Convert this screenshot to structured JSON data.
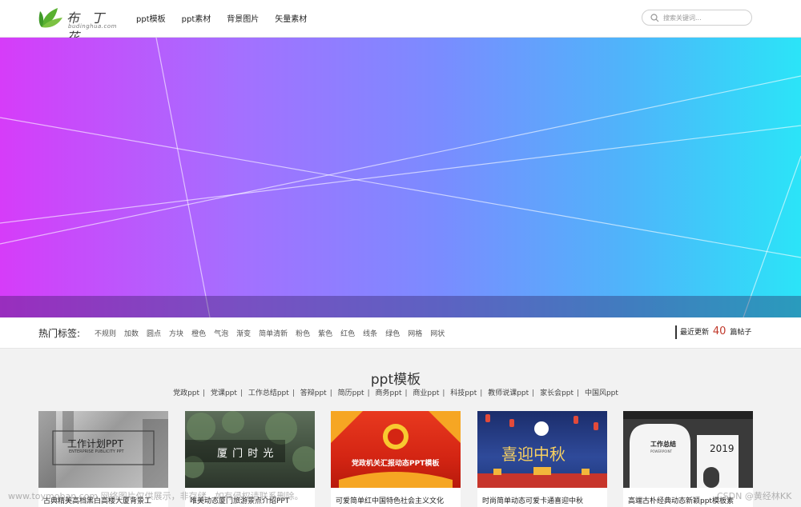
{
  "header": {
    "logo_cn": "布 丁 花",
    "logo_en": "budinghua.com",
    "nav": [
      "ppt模板",
      "ppt素材",
      "背景图片",
      "矢量素材"
    ],
    "search_placeholder": "搜索关键词..."
  },
  "hot_tags": {
    "title": "热门标签:",
    "tags": [
      "不规则",
      "加数",
      "圆点",
      "方块",
      "橙色",
      "气泡",
      "渐变",
      "简单清新",
      "粉色",
      "紫色",
      "红色",
      "线条",
      "绿色",
      "网格",
      "网状"
    ],
    "update_prefix": "最近更新",
    "update_count": "40",
    "update_suffix": "篇帖子"
  },
  "section": {
    "title": "ppt模板",
    "sub_links": [
      "党政ppt",
      "党课ppt",
      "工作总结ppt",
      "答辩ppt",
      "简历ppt",
      "商务ppt",
      "商业ppt",
      "科技ppt",
      "教师说课ppt",
      "家长会ppt",
      "中国风ppt"
    ]
  },
  "cards": [
    {
      "title": "古典精美高档黑白高楼大厦背景工",
      "thumb_title": "工作计划PPT",
      "thumb_sub": "ENTERPRISE PUBLICITY PPT"
    },
    {
      "title": "唯美动态厦门旅游景点介绍PPT",
      "thumb_title": "厦 门 时 光"
    },
    {
      "title": "可爱简单红中国特色社会主义文化",
      "thumb_title": "党政机关汇报动态PPT模板"
    },
    {
      "title": "时尚简单动态可爱卡通喜迎中秋",
      "thumb_title": "喜迎中秋"
    },
    {
      "title": "高端古朴经典动态新颖ppt模板素",
      "thumb_title": "工作总结",
      "thumb_sub": "POWERPOINT",
      "thumb_year": "2019"
    }
  ],
  "watermark": {
    "left": "www.toymoban.com 网络图片仅供展示，非存储，如有侵权请联系删除。",
    "right": "CSDN @黄经林KK"
  }
}
